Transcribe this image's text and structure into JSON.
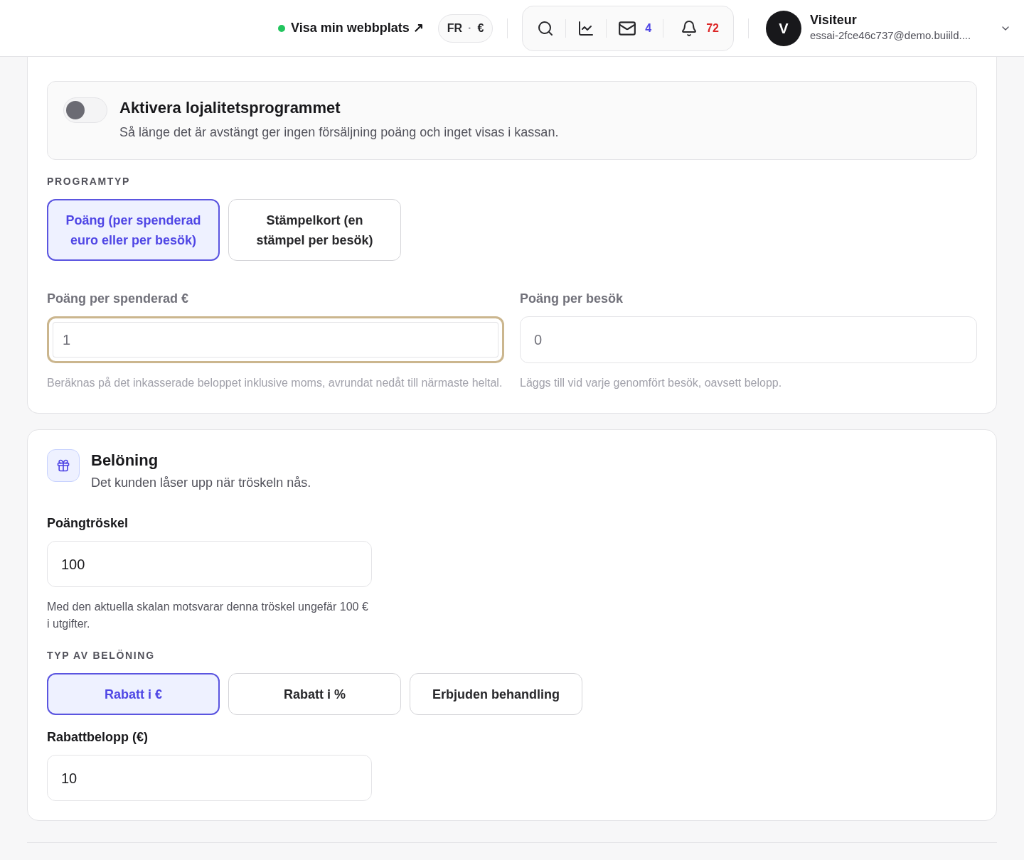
{
  "header": {
    "site_link": {
      "label": "Visa min webbplats ↗",
      "online": true
    },
    "locale": {
      "language": "FR",
      "separator": "·",
      "currency": "€"
    },
    "messages_count": "4",
    "notifications_count": "72",
    "user": {
      "initial": "V",
      "name": "Visiteur",
      "email": "essai-2fce46c737@demo.buiild...."
    }
  },
  "program": {
    "toggle": {
      "title": "Aktivera lojalitetsprogrammet",
      "description": "Så länge det är avstängt ger ingen försäljning poäng och inget visas i kassan.",
      "on": false
    },
    "type_label": "PROGRAMTYP",
    "types": [
      {
        "label": "Poäng (per spenderad euro eller per besök)",
        "selected": true
      },
      {
        "label": "Stämpelkort (en stämpel per besök)",
        "selected": false
      }
    ],
    "fields": [
      {
        "label": "Poäng per spenderad €",
        "value": "1",
        "focused": true,
        "help": "Beräknas på det inkasserade beloppet inklusive moms, avrundat nedåt till närmaste heltal."
      },
      {
        "label": "Poäng per besök",
        "value": "0",
        "focused": false,
        "help": "Läggs till vid varje genomfört besök, oavsett belopp."
      }
    ]
  },
  "reward": {
    "title": "Belöning",
    "subtitle": "Det kunden låser upp när tröskeln nås.",
    "threshold": {
      "label": "Poängtröskel",
      "value": "100",
      "help": "Med den aktuella skalan motsvarar denna tröskel ungefär 100 € i utgifter."
    },
    "type_label": "TYP AV BELÖNING",
    "types": [
      {
        "label": "Rabatt i €",
        "selected": true
      },
      {
        "label": "Rabatt i %",
        "selected": false
      },
      {
        "label": "Erbjuden behandling",
        "selected": false
      }
    ],
    "amount": {
      "label": "Rabattbelopp (€)",
      "value": "10"
    }
  }
}
